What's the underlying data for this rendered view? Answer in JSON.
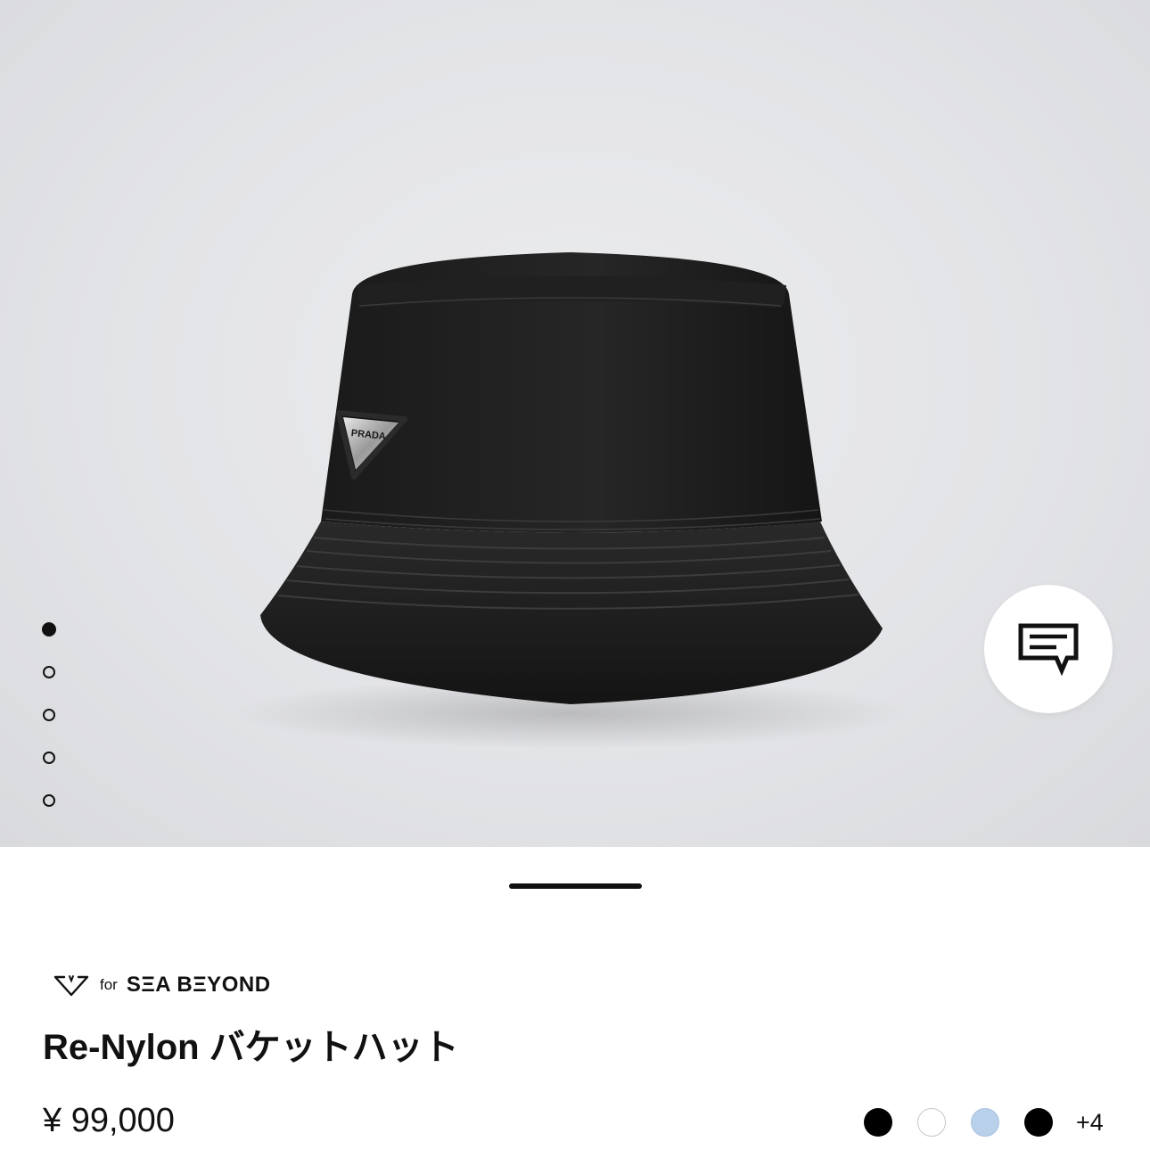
{
  "product": {
    "sustainability_for": "for",
    "sustainability_brand": "SΞA BΞYOND",
    "title": "Re-Nylon バケットハット",
    "price": "¥ 99,000",
    "logo_text": "PRADA",
    "image_count": 5,
    "active_image_index": 0
  },
  "colors": {
    "swatches": [
      {
        "name": "black",
        "hex": "#000000"
      },
      {
        "name": "white",
        "hex": "#ffffff"
      },
      {
        "name": "light-blue",
        "hex": "#b9d0ea"
      },
      {
        "name": "black-2",
        "hex": "#000000"
      }
    ],
    "more_label": "+4"
  },
  "icons": {
    "chat": "chat-bubble-icon",
    "sea_beyond": "sea-beyond-logo-icon"
  }
}
